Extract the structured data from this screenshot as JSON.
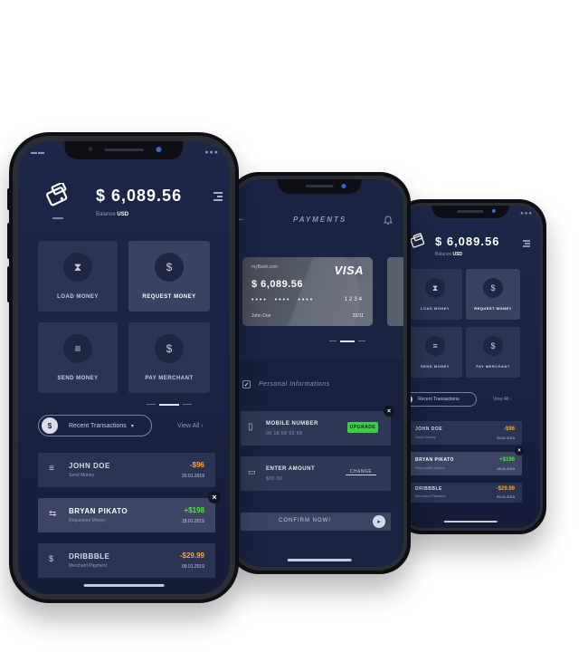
{
  "main": {
    "balance": "$ 6,089.56",
    "balance_label_prefix": "Balance",
    "balance_currency": "USD",
    "menu_icon": "menu-lines-icon",
    "wallet_icon": "wallet-icon",
    "actions": [
      {
        "label": "LOAD MONEY",
        "icon": "hourglass-icon"
      },
      {
        "label": "REQUEST MONEY",
        "icon": "money-request-icon"
      },
      {
        "label": "SEND MONEY",
        "icon": "send-lines-icon"
      },
      {
        "label": "PAY MERCHANT",
        "icon": "dollar-coin-icon"
      }
    ],
    "recent_transactions": "Recent Transactions",
    "view_all": "View All",
    "transactions": [
      {
        "name": "JOHN DOE",
        "type": "Send Money",
        "amount": "-$96",
        "date": "20.01.2019",
        "amount_color": "#f2a33b"
      },
      {
        "name": "BRYAN PIKATO",
        "type": "Requested Money",
        "amount": "+$198",
        "date": "18.01.2019",
        "amount_color": "#4ee34a"
      },
      {
        "name": "DRIBBBLE",
        "type": "Merchant Payment",
        "amount": "-$29.99",
        "date": "09.01.2019",
        "amount_color": "#f2a33b"
      }
    ]
  },
  "payments": {
    "title": "PAYMENTS",
    "card": {
      "bank": "myBank.com",
      "brand": "VISA",
      "balance": "$ 6,089.56",
      "number_masked": "•••• •••• •••• 1234",
      "last4": "1234",
      "holder": "John Doe",
      "expiry": "22/11"
    },
    "personal_info": "Personal Informations",
    "mobile_label": "MOBILE NUMBER",
    "mobile_value": "00 18 58 92 68",
    "upgrade": "UPGRADE",
    "amount_label": "ENTER AMOUNT",
    "amount_value": "$00.00",
    "change": "CHANGE",
    "confirm": "CONFIRM NOW!"
  },
  "colors": {
    "accent_green": "#4ee34a",
    "accent_orange": "#f2a33b",
    "bg_navy": "#1d2647"
  }
}
